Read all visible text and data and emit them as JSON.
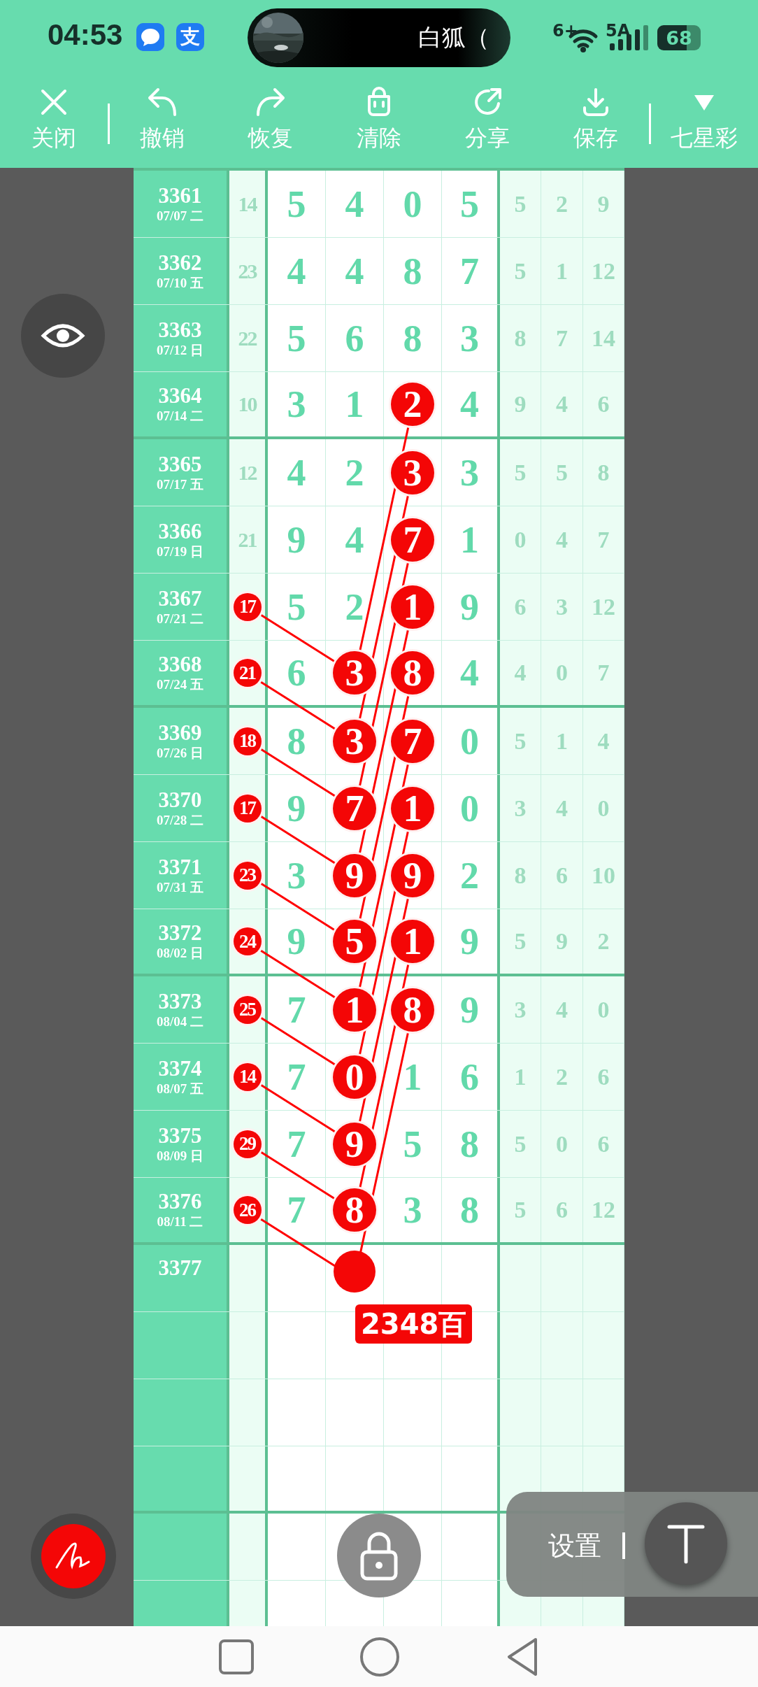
{
  "status_bar": {
    "time": "04:53",
    "app_badge": "支",
    "island_text": "白狐（",
    "network": "6+",
    "signal": "5A",
    "battery": "68"
  },
  "toolbar": [
    {
      "kind": "close",
      "label": "关闭"
    },
    {
      "kind": "separator"
    },
    {
      "kind": "undo",
      "label": "撤销"
    },
    {
      "kind": "redo",
      "label": "恢复"
    },
    {
      "kind": "clear",
      "label": "清除"
    },
    {
      "kind": "share",
      "label": "分享"
    },
    {
      "kind": "save",
      "label": "保存"
    },
    {
      "kind": "separator"
    },
    {
      "kind": "lottery",
      "label": "七星彩"
    }
  ],
  "table": {
    "rows": [
      {
        "issue": "3361",
        "date": "07/07 二",
        "sum": {
          "text": "14",
          "circled": false
        },
        "digits": [
          {
            "text": "5",
            "circled": false
          },
          {
            "text": "4",
            "circled": false
          },
          {
            "text": "0",
            "circled": false
          },
          {
            "text": "5",
            "circled": false
          }
        ],
        "tail": [
          "5",
          "2",
          "9"
        ]
      },
      {
        "issue": "3362",
        "date": "07/10 五",
        "sum": {
          "text": "23",
          "circled": false
        },
        "digits": [
          {
            "text": "4",
            "circled": false
          },
          {
            "text": "4",
            "circled": false
          },
          {
            "text": "8",
            "circled": false
          },
          {
            "text": "7",
            "circled": false
          }
        ],
        "tail": [
          "5",
          "1",
          "12"
        ]
      },
      {
        "issue": "3363",
        "date": "07/12 日",
        "sum": {
          "text": "22",
          "circled": false
        },
        "digits": [
          {
            "text": "5",
            "circled": false
          },
          {
            "text": "6",
            "circled": false
          },
          {
            "text": "8",
            "circled": false
          },
          {
            "text": "3",
            "circled": false
          }
        ],
        "tail": [
          "8",
          "7",
          "14"
        ]
      },
      {
        "issue": "3364",
        "date": "07/14 二",
        "sum": {
          "text": "10",
          "circled": false
        },
        "digits": [
          {
            "text": "3",
            "circled": false
          },
          {
            "text": "1",
            "circled": false
          },
          {
            "text": "2",
            "circled": true
          },
          {
            "text": "4",
            "circled": false
          }
        ],
        "tail": [
          "9",
          "4",
          "6"
        ]
      },
      {
        "issue": "3365",
        "date": "07/17 五",
        "sum": {
          "text": "12",
          "circled": false
        },
        "digits": [
          {
            "text": "4",
            "circled": false
          },
          {
            "text": "2",
            "circled": false
          },
          {
            "text": "3",
            "circled": true
          },
          {
            "text": "3",
            "circled": false
          }
        ],
        "tail": [
          "5",
          "5",
          "8"
        ]
      },
      {
        "issue": "3366",
        "date": "07/19 日",
        "sum": {
          "text": "21",
          "circled": false
        },
        "digits": [
          {
            "text": "9",
            "circled": false
          },
          {
            "text": "4",
            "circled": false
          },
          {
            "text": "7",
            "circled": true
          },
          {
            "text": "1",
            "circled": false
          }
        ],
        "tail": [
          "0",
          "4",
          "7"
        ]
      },
      {
        "issue": "3367",
        "date": "07/21 二",
        "sum": {
          "text": "17",
          "circled": true
        },
        "digits": [
          {
            "text": "5",
            "circled": false
          },
          {
            "text": "2",
            "circled": false
          },
          {
            "text": "1",
            "circled": true
          },
          {
            "text": "9",
            "circled": false
          }
        ],
        "tail": [
          "6",
          "3",
          "12"
        ]
      },
      {
        "issue": "3368",
        "date": "07/24 五",
        "sum": {
          "text": "21",
          "circled": true
        },
        "digits": [
          {
            "text": "6",
            "circled": false
          },
          {
            "text": "3",
            "circled": true
          },
          {
            "text": "8",
            "circled": true
          },
          {
            "text": "4",
            "circled": false
          }
        ],
        "tail": [
          "4",
          "0",
          "7"
        ]
      },
      {
        "issue": "3369",
        "date": "07/26 日",
        "sum": {
          "text": "18",
          "circled": true
        },
        "digits": [
          {
            "text": "8",
            "circled": false
          },
          {
            "text": "3",
            "circled": true
          },
          {
            "text": "7",
            "circled": true
          },
          {
            "text": "0",
            "circled": false
          }
        ],
        "tail": [
          "5",
          "1",
          "4"
        ]
      },
      {
        "issue": "3370",
        "date": "07/28 二",
        "sum": {
          "text": "17",
          "circled": true
        },
        "digits": [
          {
            "text": "9",
            "circled": false
          },
          {
            "text": "7",
            "circled": true
          },
          {
            "text": "1",
            "circled": true
          },
          {
            "text": "0",
            "circled": false
          }
        ],
        "tail": [
          "3",
          "4",
          "0"
        ]
      },
      {
        "issue": "3371",
        "date": "07/31 五",
        "sum": {
          "text": "23",
          "circled": true
        },
        "digits": [
          {
            "text": "3",
            "circled": false
          },
          {
            "text": "9",
            "circled": true
          },
          {
            "text": "9",
            "circled": true
          },
          {
            "text": "2",
            "circled": false
          }
        ],
        "tail": [
          "8",
          "6",
          "10"
        ]
      },
      {
        "issue": "3372",
        "date": "08/02 日",
        "sum": {
          "text": "24",
          "circled": true
        },
        "digits": [
          {
            "text": "9",
            "circled": false
          },
          {
            "text": "5",
            "circled": true
          },
          {
            "text": "1",
            "circled": true
          },
          {
            "text": "9",
            "circled": false
          }
        ],
        "tail": [
          "5",
          "9",
          "2"
        ]
      },
      {
        "issue": "3373",
        "date": "08/04 二",
        "sum": {
          "text": "25",
          "circled": true
        },
        "digits": [
          {
            "text": "7",
            "circled": false
          },
          {
            "text": "1",
            "circled": true
          },
          {
            "text": "8",
            "circled": true
          },
          {
            "text": "9",
            "circled": false
          }
        ],
        "tail": [
          "3",
          "4",
          "0"
        ]
      },
      {
        "issue": "3374",
        "date": "08/07 五",
        "sum": {
          "text": "14",
          "circled": true
        },
        "digits": [
          {
            "text": "7",
            "circled": false
          },
          {
            "text": "0",
            "circled": true
          },
          {
            "text": "1",
            "circled": false
          },
          {
            "text": "6",
            "circled": false
          }
        ],
        "tail": [
          "1",
          "2",
          "6"
        ]
      },
      {
        "issue": "3375",
        "date": "08/09 日",
        "sum": {
          "text": "29",
          "circled": true
        },
        "digits": [
          {
            "text": "7",
            "circled": false
          },
          {
            "text": "9",
            "circled": true
          },
          {
            "text": "5",
            "circled": false
          },
          {
            "text": "8",
            "circled": false
          }
        ],
        "tail": [
          "5",
          "0",
          "6"
        ]
      },
      {
        "issue": "3376",
        "date": "08/11 二",
        "sum": {
          "text": "26",
          "circled": true
        },
        "digits": [
          {
            "text": "7",
            "circled": false
          },
          {
            "text": "8",
            "circled": true
          },
          {
            "text": "3",
            "circled": false
          },
          {
            "text": "8",
            "circled": false
          }
        ],
        "tail": [
          "5",
          "6",
          "12"
        ]
      }
    ],
    "prediction": {
      "issue": "3377",
      "label": "2348百"
    }
  },
  "settings_panel": {
    "label": "设置"
  }
}
